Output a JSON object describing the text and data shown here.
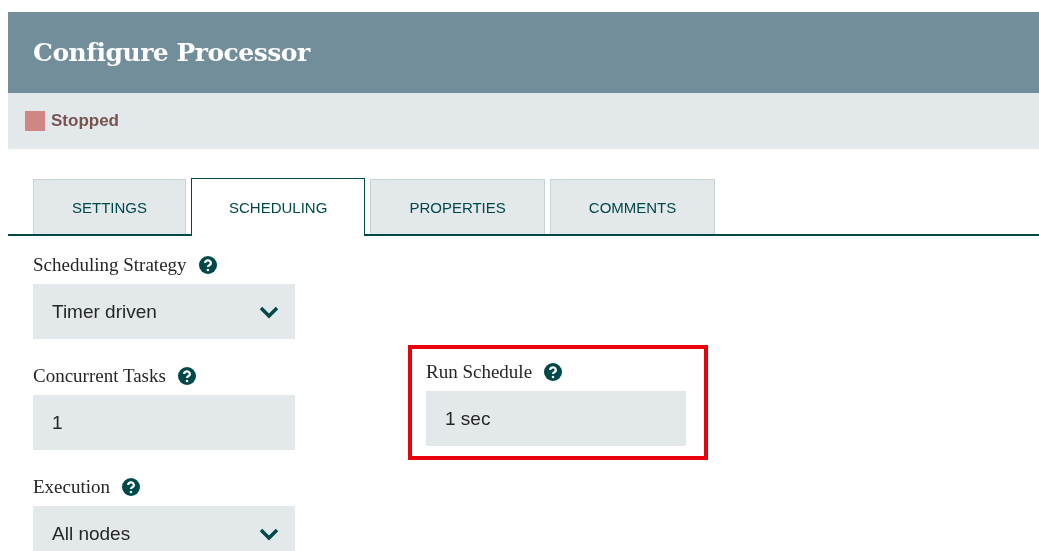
{
  "window": {
    "title": "Configure Processor"
  },
  "status": {
    "label": "Stopped",
    "color": "#d18686"
  },
  "tabs": [
    {
      "label": "SETTINGS",
      "selected": false
    },
    {
      "label": "SCHEDULING",
      "selected": true
    },
    {
      "label": "PROPERTIES",
      "selected": false
    },
    {
      "label": "COMMENTS",
      "selected": false
    }
  ],
  "left_fields": [
    {
      "label": "Scheduling Strategy",
      "kind": "select",
      "value": "Timer driven"
    },
    {
      "label": "Concurrent Tasks",
      "kind": "text",
      "value": "1"
    },
    {
      "label": "Execution",
      "kind": "select",
      "value": "All nodes"
    }
  ],
  "right_fields": [
    {
      "label": "Run Schedule",
      "kind": "text",
      "value": "1 sec",
      "highlighted": true
    }
  ]
}
